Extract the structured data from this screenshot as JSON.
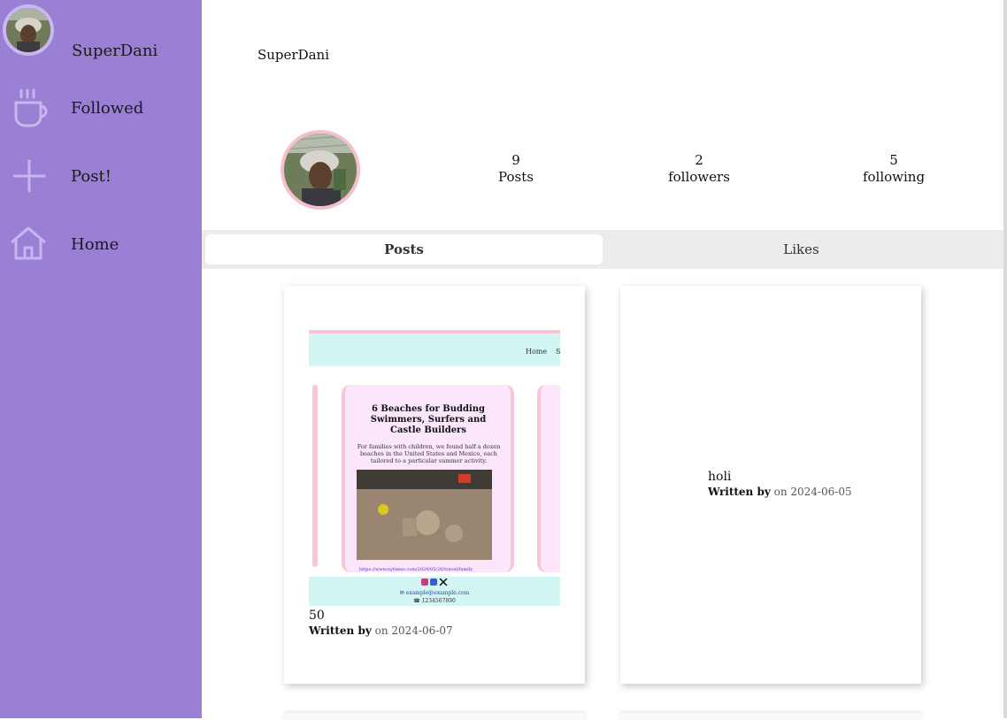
{
  "sidebar": {
    "username": "SuperDani",
    "nav": [
      {
        "label": "Followed",
        "icon": "coffee-cup-icon"
      },
      {
        "label": "Post!",
        "icon": "plus-icon"
      },
      {
        "label": "Home",
        "icon": "home-icon"
      }
    ],
    "icon_color": "#c7b6f0",
    "background": "#9a80d4"
  },
  "profile": {
    "name": "SuperDani",
    "stats": [
      {
        "value": "9",
        "label": "Posts"
      },
      {
        "value": "2",
        "label": "followers"
      },
      {
        "value": "5",
        "label": "following"
      }
    ]
  },
  "tabs": [
    {
      "label": "Posts",
      "active": true
    },
    {
      "label": "Likes",
      "active": false
    }
  ],
  "posts": [
    {
      "title": "50",
      "written_by": "Written by",
      "date_text": "on 2024-06-07",
      "preview": {
        "nav": [
          "Home",
          "S"
        ],
        "card_title": "6 Beaches for Budding Swimmers, Surfers and Castle Builders",
        "card_text": "For families with children, we found half a dozen beaches in the United States and Mexico, each tailored to a particular summer activity.",
        "link": "https://www.nytimes.com/2024/05/26/travel/family",
        "footer_email": "example@example.com",
        "footer_phone": "1234567890"
      }
    },
    {
      "title": "holi",
      "written_by": "Written by",
      "date_text": "on 2024-06-05"
    }
  ]
}
